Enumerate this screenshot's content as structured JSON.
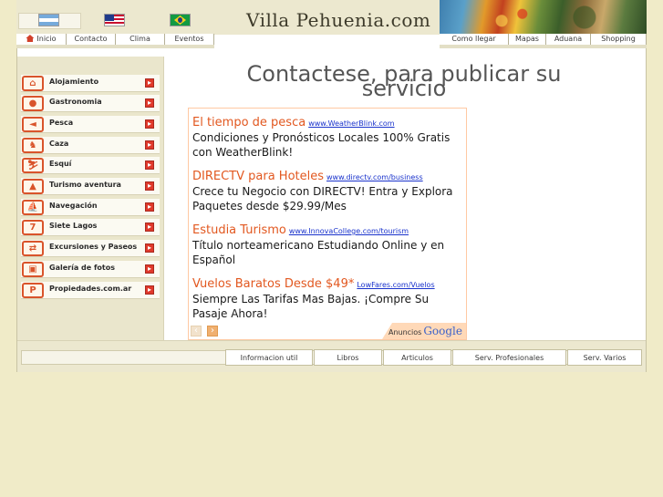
{
  "header": {
    "logo_text": "Villa Pehuenia.com",
    "flags": [
      "argentina-flag",
      "usa-flag",
      "brazil-flag"
    ]
  },
  "topnav_left": [
    "Inicio",
    "Contacto",
    "Clima",
    "Eventos"
  ],
  "topnav_right": [
    "Como llegar",
    "Mapas",
    "Aduana",
    "Shopping"
  ],
  "sidebar": {
    "items": [
      {
        "label": "Alojamiento",
        "icon": "bed-icon",
        "glyph": "⌂"
      },
      {
        "label": "Gastronomia",
        "icon": "plate-icon",
        "glyph": "●"
      },
      {
        "label": "Pesca",
        "icon": "fish-icon",
        "glyph": "◄"
      },
      {
        "label": "Caza",
        "icon": "deer-icon",
        "glyph": "♞"
      },
      {
        "label": "Esquí",
        "icon": "ski-icon",
        "glyph": "⛷"
      },
      {
        "label": "Turismo aventura",
        "icon": "mountain-icon",
        "glyph": "▲"
      },
      {
        "label": "Navegación",
        "icon": "boat-icon",
        "glyph": "⛵"
      },
      {
        "label": "Siete Lagos",
        "icon": "seven-icon",
        "glyph": "7"
      },
      {
        "label": "Excursiones y Paseos",
        "icon": "signpost-icon",
        "glyph": "⇄"
      },
      {
        "label": "Galería de fotos",
        "icon": "photo-icon",
        "glyph": "▣"
      },
      {
        "label": "Propiedades.com.ar",
        "icon": "p-icon",
        "glyph": "P"
      }
    ]
  },
  "main": {
    "title": "Contactese, para publicar su servicio"
  },
  "ads": [
    {
      "title": "El tiempo de pesca",
      "url": "www.WeatherBlink.com",
      "text": "Condiciones y Pronósticos Locales 100% Gratis con WeatherBlink!"
    },
    {
      "title": "DIRECTV para Hoteles",
      "url": "www.directv.com/business",
      "text": "Crece tu Negocio con DIRECTV! Entra y Explora Paquetes desde $29.99/Mes"
    },
    {
      "title": "Estudia Turismo",
      "url": "www.InnovaCollege.com/tourism",
      "text": "Título norteamericano Estudiando Online y en Español"
    },
    {
      "title": "Vuelos Baratos Desde $49*",
      "url": "LowFares.com/Vuelos",
      "text": "Siempre Las Tarifas Mas Bajas. ¡Compre Su Pasaje Ahora!"
    }
  ],
  "ad_badge": {
    "label": "Anuncios",
    "brand": "Google"
  },
  "bottom_nav": [
    "Informacion util",
    "Libros",
    "Articulos",
    "Serv. Profesionales",
    "Serv. Varios"
  ],
  "colors": {
    "background": "#f0ebc8",
    "accent": "#e25820",
    "link": "#1a33cc",
    "icon_border": "#d9542b"
  }
}
